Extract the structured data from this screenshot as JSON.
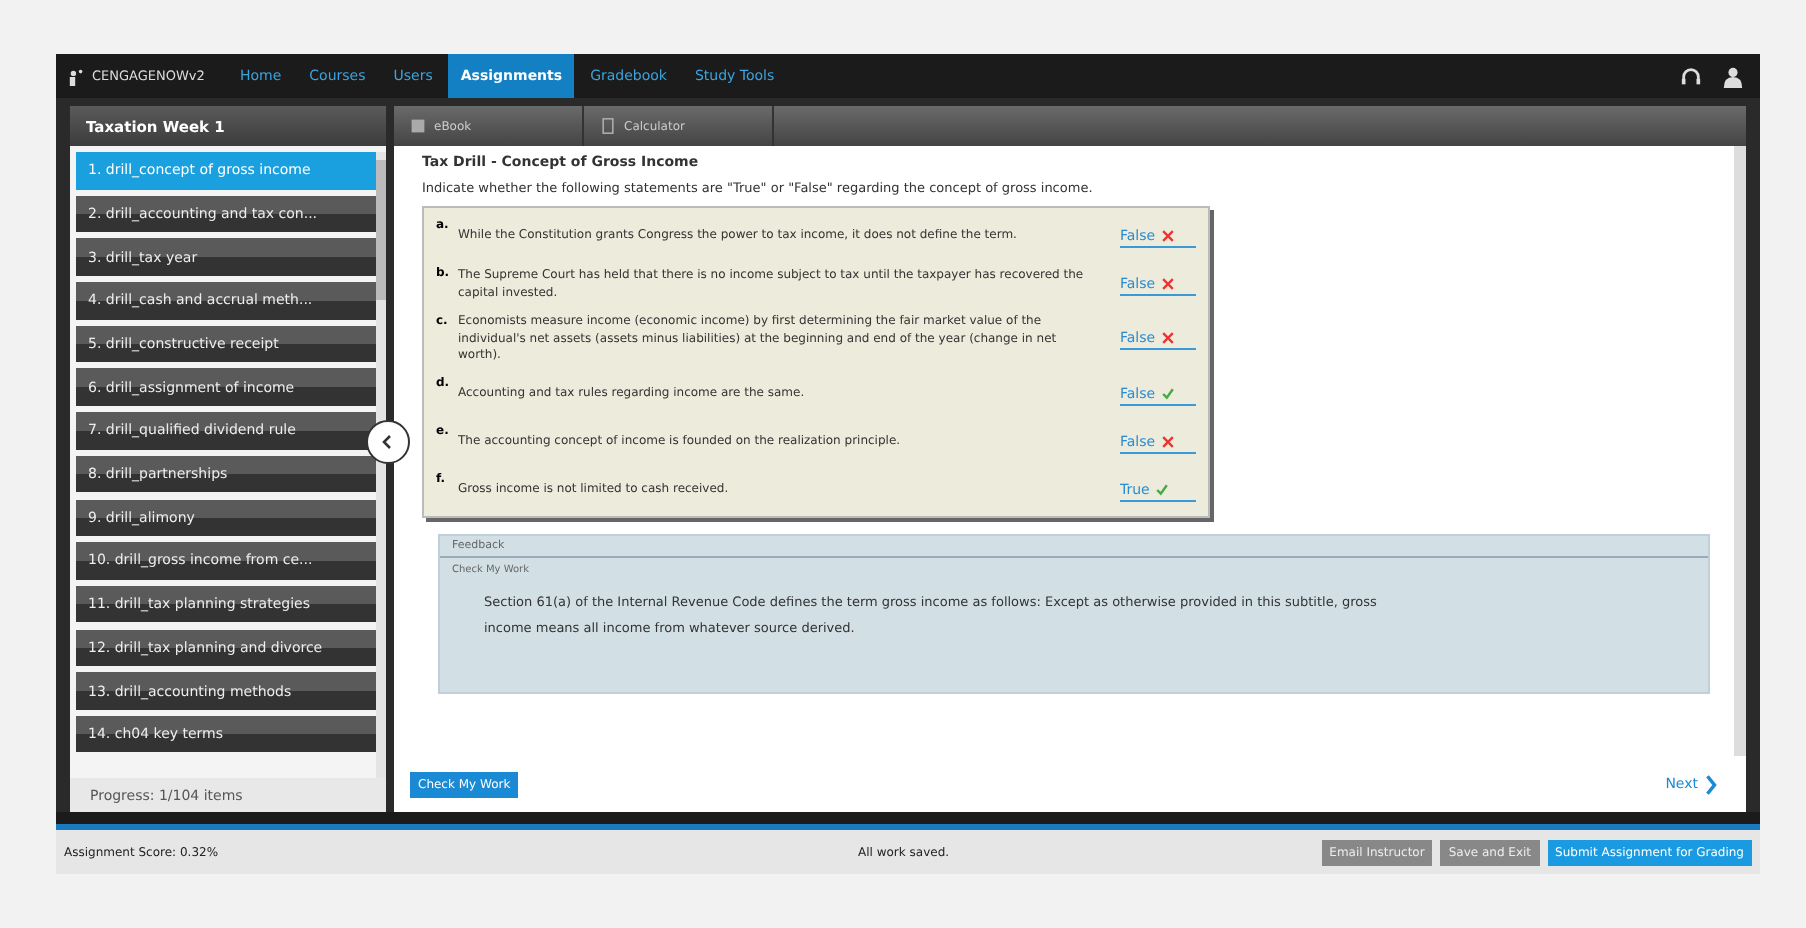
{
  "brand": "CENGAGENOWv2",
  "nav": [
    {
      "label": "Home",
      "selected": false
    },
    {
      "label": "Courses",
      "selected": false
    },
    {
      "label": "Users",
      "selected": false
    },
    {
      "label": "Assignments",
      "selected": true
    },
    {
      "label": "Gradebook",
      "selected": false
    },
    {
      "label": "Study Tools",
      "selected": false
    }
  ],
  "sidebar": {
    "title": "Taxation Week 1",
    "items": [
      {
        "label": "1. drill_concept of gross income",
        "selected": true
      },
      {
        "label": "2. drill_accounting and tax con...",
        "selected": false
      },
      {
        "label": "3. drill_tax year",
        "selected": false
      },
      {
        "label": "4. drill_cash and accrual meth...",
        "selected": false
      },
      {
        "label": "5. drill_constructive receipt",
        "selected": false
      },
      {
        "label": "6. drill_assignment of income",
        "selected": false
      },
      {
        "label": "7. drill_qualified dividend rule",
        "selected": false
      },
      {
        "label": "8. drill_partnerships",
        "selected": false
      },
      {
        "label": "9. drill_alimony",
        "selected": false
      },
      {
        "label": "10. drill_gross income from ce...",
        "selected": false
      },
      {
        "label": "11. drill_tax planning strategies",
        "selected": false
      },
      {
        "label": "12. drill_tax planning and divorce",
        "selected": false
      },
      {
        "label": "13. drill_accounting methods",
        "selected": false
      },
      {
        "label": "14. ch04 key terms",
        "selected": false
      }
    ],
    "progress": "Progress:  1/104 items"
  },
  "toolbar": [
    "eBook",
    "Calculator"
  ],
  "question": {
    "title": "Tax Drill - Concept of Gross Income",
    "instruction": "Indicate whether the following statements are \"True\" or \"False\" regarding the concept of gross income.",
    "statements": [
      {
        "letter": "a.",
        "text": "While the Constitution grants Congress the power to tax income, it does not define the term.",
        "answer": "False",
        "correct": false
      },
      {
        "letter": "b.",
        "text": "The Supreme Court has held that there is no income subject to tax until the taxpayer has recovered the capital invested.",
        "answer": "False",
        "correct": false
      },
      {
        "letter": "c.",
        "text": "Economists measure income (economic income) by first determining the fair market value of the individual's net assets (assets minus liabilities) at the beginning and end of the year (change in net worth).",
        "answer": "False",
        "correct": false
      },
      {
        "letter": "d.",
        "text": "Accounting and tax rules regarding income are the same.",
        "answer": "False",
        "correct": true
      },
      {
        "letter": "e.",
        "text": "The accounting concept of income is founded on the realization principle.",
        "answer": "False",
        "correct": false
      },
      {
        "letter": "f.",
        "text": "Gross income is not limited to cash received.",
        "answer": "True",
        "correct": true
      }
    ]
  },
  "feedback": {
    "title": "Feedback",
    "subtitle": "Check My Work",
    "text": "Section 61(a) of the Internal Revenue Code defines the term gross income as follows: Except as otherwise provided in this subtitle, gross income means all income from whatever source derived."
  },
  "check_button": "Check My Work",
  "next_link": "Next",
  "footer": {
    "score": "Assignment Score: 0.32%",
    "status": "All work saved.",
    "buttons": [
      {
        "label": "Email Instructor",
        "kind": "secondary"
      },
      {
        "label": "Save and Exit",
        "kind": "secondary"
      },
      {
        "label": "Submit Assignment for Grading",
        "kind": "primary"
      }
    ]
  }
}
